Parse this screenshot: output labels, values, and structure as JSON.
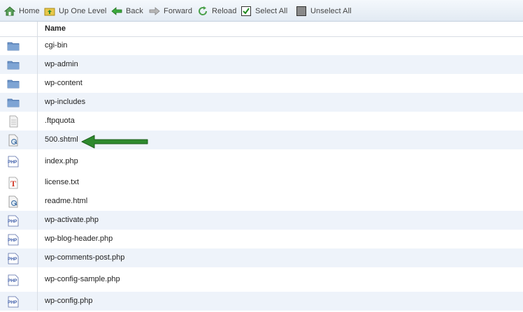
{
  "toolbar": {
    "home": "Home",
    "up_one_level": "Up One Level",
    "back": "Back",
    "forward": "Forward",
    "reload": "Reload",
    "select_all": "Select All",
    "unselect_all": "Unselect All"
  },
  "table": {
    "column_name": "Name",
    "files": [
      {
        "name": "cgi-bin",
        "icon": "folder-icon"
      },
      {
        "name": "wp-admin",
        "icon": "folder-icon"
      },
      {
        "name": "wp-content",
        "icon": "folder-icon"
      },
      {
        "name": "wp-includes",
        "icon": "folder-icon"
      },
      {
        "name": ".ftpquota",
        "icon": "file-icon"
      },
      {
        "name": "500.shtml",
        "icon": "html-file-icon"
      },
      {
        "name": "index.php",
        "icon": "php-file-icon"
      },
      {
        "name": "license.txt",
        "icon": "text-file-icon"
      },
      {
        "name": "readme.html",
        "icon": "html-file-icon"
      },
      {
        "name": "wp-activate.php",
        "icon": "php-file-icon"
      },
      {
        "name": "wp-blog-header.php",
        "icon": "php-file-icon"
      },
      {
        "name": "wp-comments-post.php",
        "icon": "php-file-icon"
      },
      {
        "name": "wp-config-sample.php",
        "icon": "php-file-icon"
      },
      {
        "name": "wp-config.php",
        "icon": "php-file-icon"
      }
    ]
  },
  "annotation": {
    "arrow_color": "#2e8a2e",
    "points_to": "500.shtml"
  },
  "colors": {
    "alt_row": "#eef3fa",
    "folder": "#6e95c8",
    "php": "#3a5aa8",
    "text_icon": "#d23a2a"
  }
}
